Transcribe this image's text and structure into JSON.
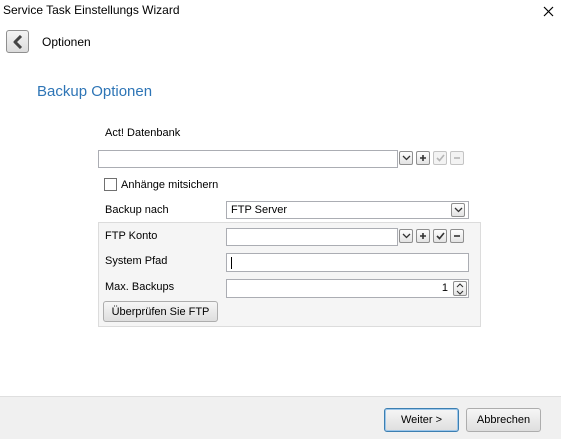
{
  "window": {
    "title": "Service Task Einstellungs Wizard"
  },
  "header": {
    "step_title": "Optionen"
  },
  "section": {
    "title": "Backup Optionen"
  },
  "database": {
    "label": "Act! Datenbank",
    "value": ""
  },
  "attachments": {
    "label": "Anhänge mitsichern",
    "checked": false
  },
  "backup_target": {
    "label": "Backup nach",
    "value": "FTP Server"
  },
  "ftp": {
    "account_label": "FTP Konto",
    "account_value": "",
    "path_label": "System Pfad",
    "path_value": "",
    "max_label": "Max. Backups",
    "max_value": "1",
    "check_button": "Überprüfen Sie FTP"
  },
  "footer": {
    "next_button": "Weiter >",
    "cancel_button": "Abbrechen"
  },
  "icons": {
    "close": "close-icon",
    "back": "chevron-left-icon",
    "dropdown": "chevron-down-icon",
    "add": "plus-icon",
    "confirm": "check-icon",
    "remove": "minus-icon"
  }
}
